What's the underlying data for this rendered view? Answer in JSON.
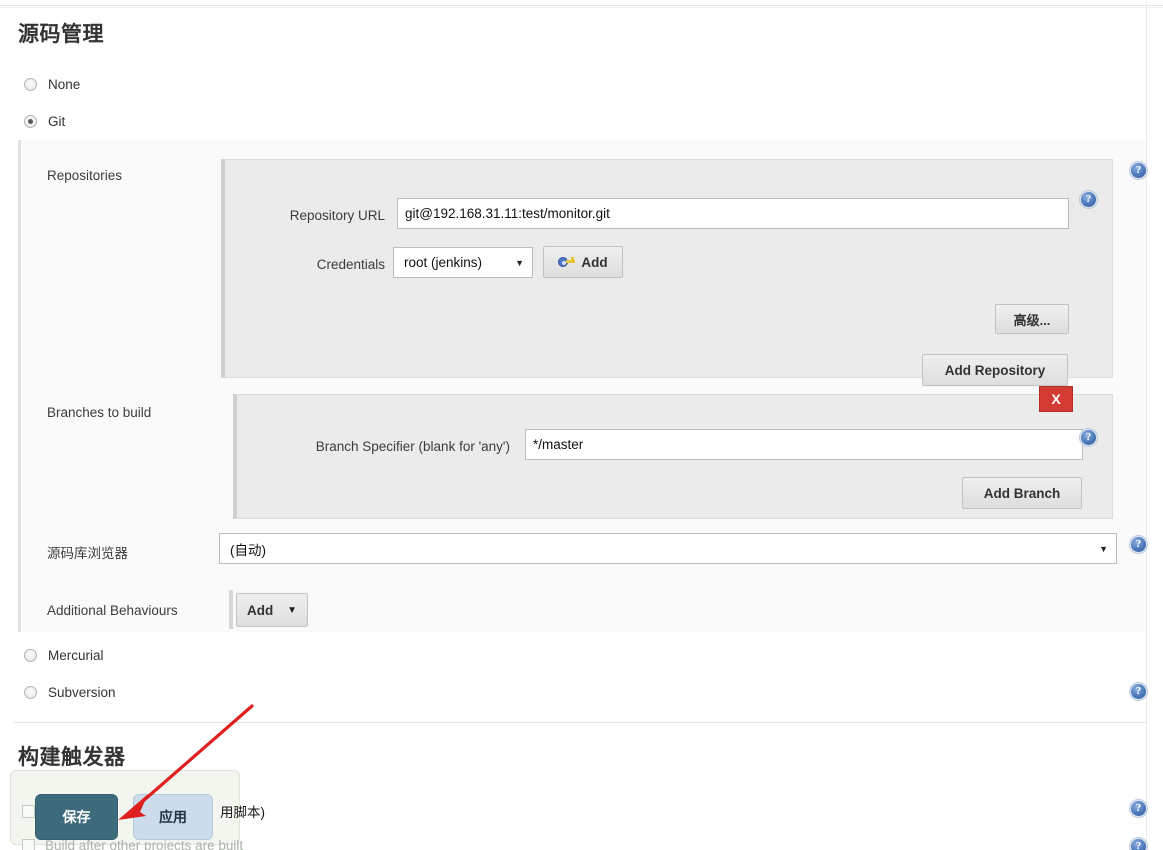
{
  "page": {
    "scm_title": "源码管理",
    "trigger_title": "构建触发器"
  },
  "scm": {
    "options": [
      {
        "label": "None",
        "selected": false
      },
      {
        "label": "Git",
        "selected": true
      },
      {
        "label": "Mercurial",
        "selected": false
      },
      {
        "label": "Subversion",
        "selected": false
      }
    ]
  },
  "git": {
    "repositories": {
      "label": "Repositories",
      "repository_url": {
        "label": "Repository URL",
        "value": "git@192.168.31.11:test/monitor.git"
      },
      "credentials": {
        "label": "Credentials",
        "selected": "root (jenkins)",
        "add_button": "Add",
        "add_icon": "key-icon"
      },
      "advanced_button": "高级...",
      "add_repository_button": "Add Repository"
    },
    "branches": {
      "label": "Branches to build",
      "delete_button": "X",
      "branch_specifier": {
        "label": "Branch Specifier (blank for 'any')",
        "value": "*/master"
      },
      "add_branch_button": "Add Branch"
    },
    "repository_browser": {
      "label": "源码库浏览器",
      "selected": "(自动)"
    },
    "additional_behaviours": {
      "label": "Additional Behaviours",
      "add_button": "Add",
      "caret": "▼"
    }
  },
  "triggers": {
    "items": [
      {
        "label_tail": "用脚本)",
        "checked": false
      },
      {
        "label": "Build after other projects are built",
        "checked": false
      }
    ]
  },
  "actions": {
    "save": "保存",
    "apply": "应用"
  },
  "icons": {
    "help": "?",
    "caret_down": "▼"
  },
  "colors": {
    "save_bg": "#3d6b7c",
    "apply_bg": "#ccdcea",
    "delete_bg": "#d33a33",
    "help_blue": "#4c79bb",
    "annotation_red": "#e02020"
  }
}
